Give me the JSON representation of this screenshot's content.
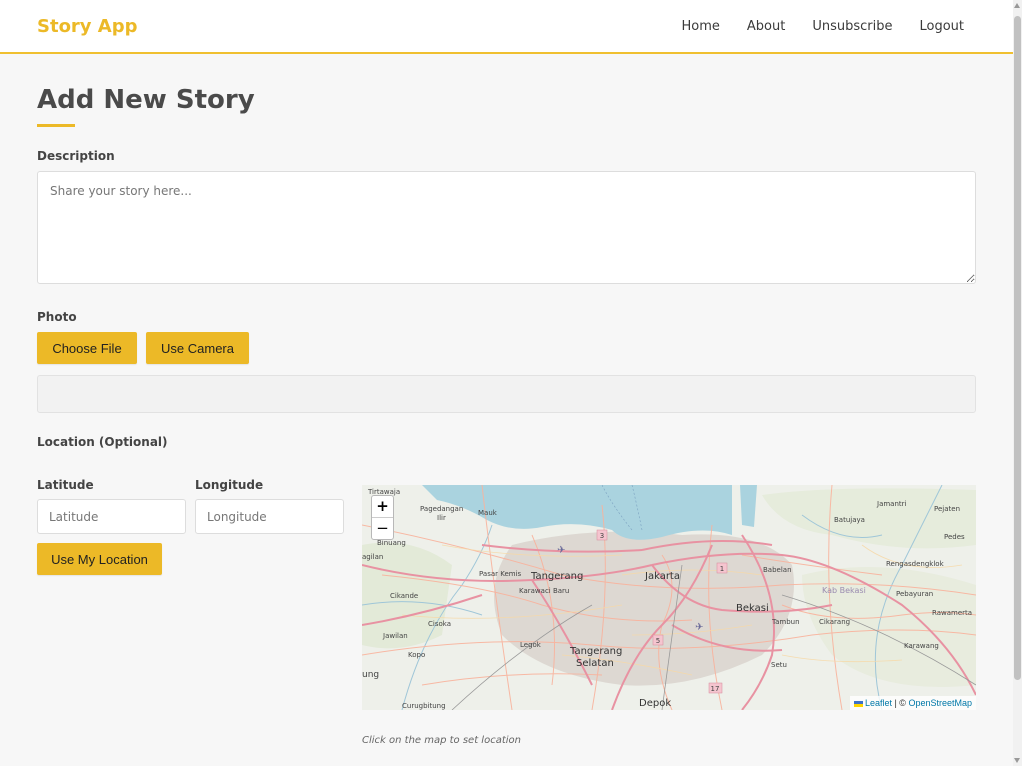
{
  "header": {
    "brand": "Story App",
    "nav": [
      "Home",
      "About",
      "Unsubscribe",
      "Logout"
    ]
  },
  "page": {
    "title": "Add New Story"
  },
  "form": {
    "description_label": "Description",
    "description_placeholder": "Share your story here...",
    "description_value": "",
    "photo_label": "Photo",
    "choose_file_label": "Choose File",
    "use_camera_label": "Use Camera",
    "location_label": "Location (Optional)",
    "latitude_label": "Latitude",
    "latitude_placeholder": "Latitude",
    "longitude_label": "Longitude",
    "longitude_placeholder": "Longitude",
    "use_location_label": "Use My Location"
  },
  "map": {
    "zoom_in": "+",
    "zoom_out": "−",
    "attribution_leaflet": "Leaflet",
    "attribution_sep": " | © ",
    "attribution_osm": "OpenStreetMap",
    "hint": "Click on the map to set location",
    "places": {
      "tirtawaja": "Tirtawaja",
      "pagedangan_ilir": "Pagedangan",
      "ilir": "Ilir",
      "mauk": "Mauk",
      "jamantri": "Jamantri",
      "pejaten": "Pejaten",
      "batujaya": "Batujaya",
      "pedes": "Pedes",
      "binuang": "Binuang",
      "agilan": "agilan",
      "pasar_kemis": "Pasar Kemis",
      "tangerang": "Tangerang",
      "jakarta": "Jakarta",
      "babelan": "Babelan",
      "rengasdengklok": "Rengasdengklok",
      "karawaci_baru": "Karawaci Baru",
      "kab_bekasi": "Kab Bekasi",
      "pebayuran": "Pebayuran",
      "cikande": "Cikande",
      "bekasi": "Bekasi",
      "cisoka": "Cisoka",
      "tambun": "Tambun",
      "cikarang": "Cikarang",
      "rawamerta": "Rawamerta",
      "jawilan": "Jawilan",
      "legok": "Legok",
      "karawang": "Karawang",
      "kopo": "Kopo",
      "tangerang_selatan_1": "Tangerang",
      "tangerang_selatan_2": "Selatan",
      "setu": "Setu",
      "ung": "ung",
      "curugbitung": "Curugbitung",
      "depok": "Depok",
      "shield_3": "3",
      "shield_1": "1",
      "shield_5": "5",
      "shield_17": "17"
    }
  },
  "colors": {
    "accent": "#ecb927",
    "sea": "#aad3df",
    "major_road": "#e892a2",
    "minor_road": "#f9b29c"
  }
}
